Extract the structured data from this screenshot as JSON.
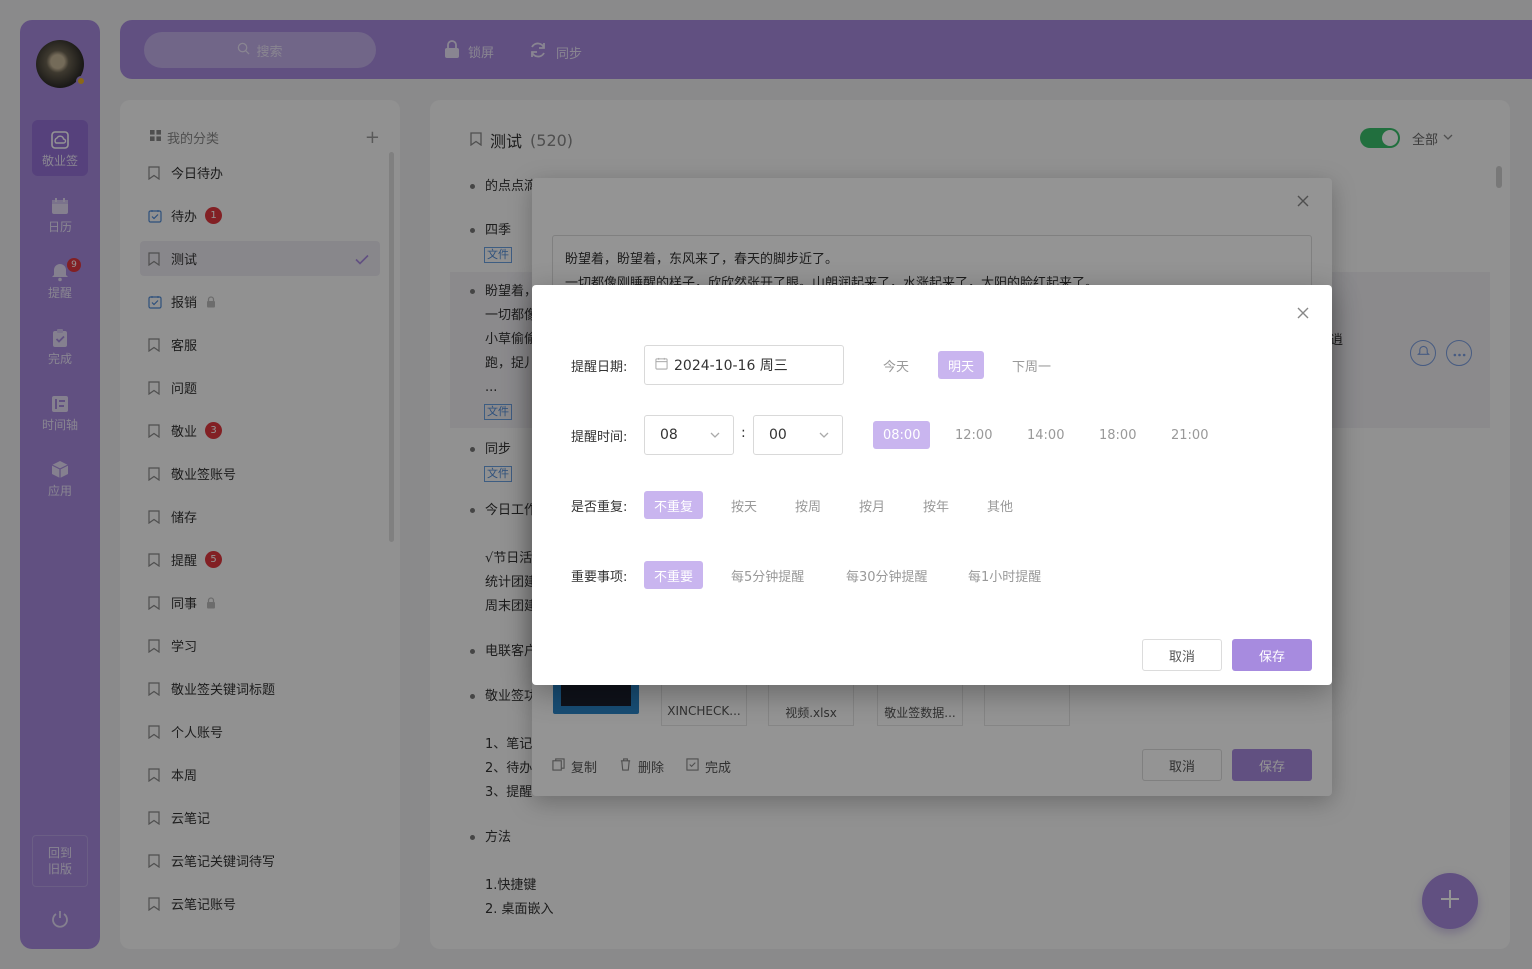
{
  "rail": {
    "items": [
      {
        "label": "敬业签",
        "icon": "note-cloud-icon",
        "active": true
      },
      {
        "label": "日历",
        "icon": "calendar-icon"
      },
      {
        "label": "提醒",
        "icon": "bell-icon",
        "badge": "9"
      },
      {
        "label": "完成",
        "icon": "clipboard-check-icon"
      },
      {
        "label": "时间轴",
        "icon": "timeline-icon"
      },
      {
        "label": "应用",
        "icon": "cube-icon"
      }
    ],
    "back_label_1": "回到",
    "back_label_2": "旧版"
  },
  "topbar": {
    "search_placeholder": "搜索",
    "lock_label": "锁屏",
    "sync_label": "同步"
  },
  "categories": {
    "header": "我的分类",
    "items": [
      {
        "label": "今日待办"
      },
      {
        "label": "待办",
        "badge": "1",
        "icon": "todo"
      },
      {
        "label": "测试",
        "active": true
      },
      {
        "label": "报销",
        "icon": "todo",
        "locked": true
      },
      {
        "label": "客服"
      },
      {
        "label": "问题"
      },
      {
        "label": "敬业",
        "badge": "3"
      },
      {
        "label": "敬业签账号"
      },
      {
        "label": "储存"
      },
      {
        "label": "提醒",
        "badge": "5"
      },
      {
        "label": "同事",
        "locked": true
      },
      {
        "label": "学习"
      },
      {
        "label": "敬业签关键词标题"
      },
      {
        "label": "个人账号"
      },
      {
        "label": "本周"
      },
      {
        "label": "云笔记"
      },
      {
        "label": "云笔记关键词待写"
      },
      {
        "label": "云笔记账号"
      }
    ]
  },
  "main": {
    "title": "测试",
    "count": "(520)",
    "filter": "全部",
    "file_tag": "文件",
    "notes": [
      {
        "line1": "的点点滴"
      },
      {
        "line1": "四季"
      },
      {
        "line1": "盼望着，",
        "line2": "一切都像",
        "line3": "小草偷偷",
        "line4": "跑，捉儿",
        "line5": "...",
        "tail": "逍"
      },
      {
        "line1": "同步"
      },
      {
        "line1": "今日工作"
      },
      {
        "line1": "√节日活",
        "line2": "统计团建",
        "line3": "周末团建"
      },
      {
        "line1": "电联客户"
      },
      {
        "line1": "敬业签功"
      },
      {
        "line1": "1、笔记",
        "line2": "2、待办",
        "line3": "3、提醒"
      },
      {
        "line1": "方法"
      },
      {
        "line1": "1.快捷键",
        "line2": "2. 桌面嵌入"
      }
    ]
  },
  "editor": {
    "text_line1": "盼望着，盼望着，东风来了，春天的脚步近了。",
    "text_line2": "一切都像刚睡醒的样子，欣欣然张开了眼。山朗润起来了，水涨起来了，太阳的脸红起来了。",
    "files": [
      "XINCHECK...",
      "视频.xlsx",
      "敬业签数据..."
    ],
    "copy_label": "复制",
    "delete_label": "删除",
    "done_label": "完成",
    "cancel_label": "取消",
    "save_label": "保存"
  },
  "reminder": {
    "date_label": "提醒日期:",
    "date_value": "2024-10-16 周三",
    "date_quick": [
      {
        "label": "今天"
      },
      {
        "label": "明天",
        "selected": true
      },
      {
        "label": "下周一"
      }
    ],
    "time_label": "提醒时间:",
    "hour": "08",
    "minute": "00",
    "colon": ":",
    "time_quick": [
      {
        "label": "08:00",
        "selected": true
      },
      {
        "label": "12:00"
      },
      {
        "label": "14:00"
      },
      {
        "label": "18:00"
      },
      {
        "label": "21:00"
      }
    ],
    "repeat_label": "是否重复:",
    "repeat_options": [
      {
        "label": "不重复",
        "selected": true
      },
      {
        "label": "按天"
      },
      {
        "label": "按周"
      },
      {
        "label": "按月"
      },
      {
        "label": "按年"
      },
      {
        "label": "其他"
      }
    ],
    "important_label": "重要事项:",
    "important_options": [
      {
        "label": "不重要",
        "selected": true
      },
      {
        "label": "每5分钟提醒"
      },
      {
        "label": "每30分钟提醒"
      },
      {
        "label": "每1小时提醒"
      }
    ],
    "cancel_label": "取消",
    "save_label": "保存"
  },
  "colors": {
    "accent": "#a78bdf",
    "chip_selected": "#c9b5ef",
    "badge": "#e0383e",
    "toggle_on": "#3ac06b"
  }
}
